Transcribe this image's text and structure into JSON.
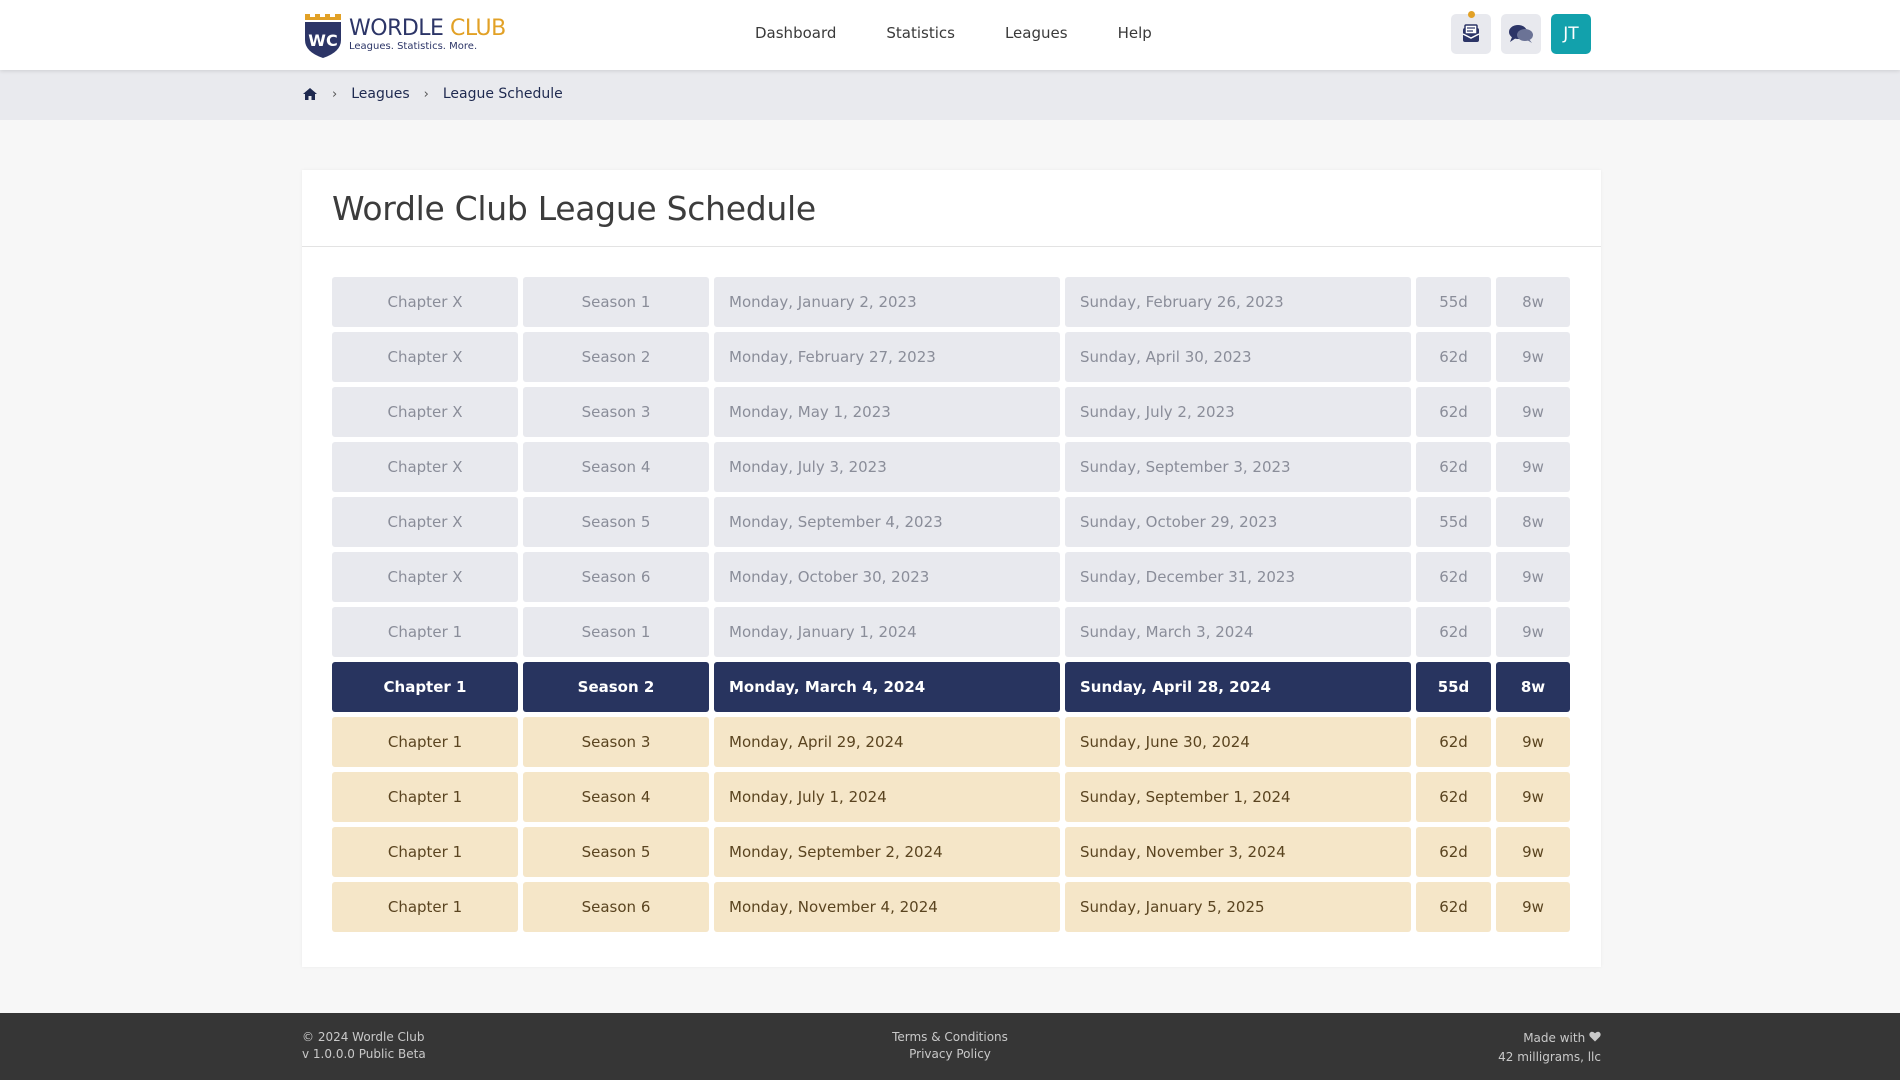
{
  "brand": {
    "name_part1": "WORDLE",
    "name_part2": "CLUB",
    "tagline": "Leagues. Statistics. More.",
    "monogram": "WC"
  },
  "nav": {
    "items": [
      {
        "label": "Dashboard"
      },
      {
        "label": "Statistics"
      },
      {
        "label": "Leagues"
      },
      {
        "label": "Help"
      }
    ]
  },
  "header_icons": {
    "inbox": "inbox-icon",
    "chat": "chat-icon",
    "avatar_initials": "JT"
  },
  "breadcrumb": {
    "home_icon": "home-icon",
    "items": [
      {
        "label": "Leagues"
      },
      {
        "label": "League Schedule"
      }
    ],
    "separator": "›"
  },
  "page": {
    "title": "Wordle Club League Schedule"
  },
  "schedule": [
    {
      "chapter": "Chapter X",
      "season": "Season 1",
      "start": "Monday, January 2, 2023",
      "end": "Sunday, February 26, 2023",
      "days": "55d",
      "weeks": "8w",
      "state": "past"
    },
    {
      "chapter": "Chapter X",
      "season": "Season 2",
      "start": "Monday, February 27, 2023",
      "end": "Sunday, April 30, 2023",
      "days": "62d",
      "weeks": "9w",
      "state": "past"
    },
    {
      "chapter": "Chapter X",
      "season": "Season 3",
      "start": "Monday, May 1, 2023",
      "end": "Sunday, July 2, 2023",
      "days": "62d",
      "weeks": "9w",
      "state": "past"
    },
    {
      "chapter": "Chapter X",
      "season": "Season 4",
      "start": "Monday, July 3, 2023",
      "end": "Sunday, September 3, 2023",
      "days": "62d",
      "weeks": "9w",
      "state": "past"
    },
    {
      "chapter": "Chapter X",
      "season": "Season 5",
      "start": "Monday, September 4, 2023",
      "end": "Sunday, October 29, 2023",
      "days": "55d",
      "weeks": "8w",
      "state": "past"
    },
    {
      "chapter": "Chapter X",
      "season": "Season 6",
      "start": "Monday, October 30, 2023",
      "end": "Sunday, December 31, 2023",
      "days": "62d",
      "weeks": "9w",
      "state": "past"
    },
    {
      "chapter": "Chapter 1",
      "season": "Season 1",
      "start": "Monday, January 1, 2024",
      "end": "Sunday, March 3, 2024",
      "days": "62d",
      "weeks": "9w",
      "state": "past"
    },
    {
      "chapter": "Chapter 1",
      "season": "Season 2",
      "start": "Monday, March 4, 2024",
      "end": "Sunday, April 28, 2024",
      "days": "55d",
      "weeks": "8w",
      "state": "current"
    },
    {
      "chapter": "Chapter 1",
      "season": "Season 3",
      "start": "Monday, April 29, 2024",
      "end": "Sunday, June 30, 2024",
      "days": "62d",
      "weeks": "9w",
      "state": "future"
    },
    {
      "chapter": "Chapter 1",
      "season": "Season 4",
      "start": "Monday, July 1, 2024",
      "end": "Sunday, September 1, 2024",
      "days": "62d",
      "weeks": "9w",
      "state": "future"
    },
    {
      "chapter": "Chapter 1",
      "season": "Season 5",
      "start": "Monday, September 2, 2024",
      "end": "Sunday, November 3, 2024",
      "days": "62d",
      "weeks": "9w",
      "state": "future"
    },
    {
      "chapter": "Chapter 1",
      "season": "Season 6",
      "start": "Monday, November 4, 2024",
      "end": "Sunday, January 5, 2025",
      "days": "62d",
      "weeks": "9w",
      "state": "future"
    }
  ],
  "colors": {
    "primary": "#28345f",
    "accent": "#e2a126",
    "avatar_bg": "#12a1ac",
    "past_bg": "#e8e9ee",
    "future_bg": "#f5e6c8",
    "footer_bg": "#363636"
  },
  "footer": {
    "copyright": "© 2024 Wordle Club",
    "version": "v 1.0.0.0 Public Beta",
    "terms": "Terms & Conditions",
    "privacy": "Privacy Policy",
    "made_with": "Made with",
    "heart_icon": "heart-icon",
    "company": "42 milligrams, llc"
  }
}
